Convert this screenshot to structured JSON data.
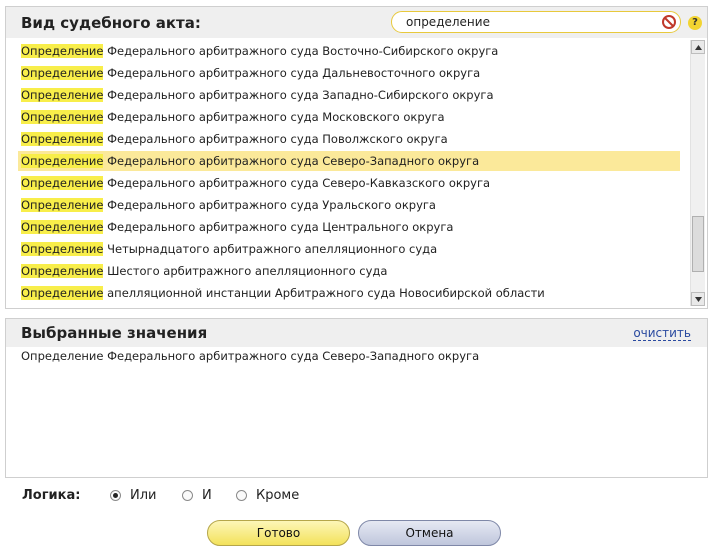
{
  "panel": {
    "title": "Вид судебного акта:",
    "search_value": "определение"
  },
  "help": {
    "glyph": "?"
  },
  "list": {
    "highlight": "Определение",
    "items": [
      {
        "rest": " Федерального арбитражного суда Восточно-Сибирского округа",
        "selected": false
      },
      {
        "rest": " Федерального арбитражного суда Дальневосточного округа",
        "selected": false
      },
      {
        "rest": " Федерального арбитражного суда Западно-Сибирского округа",
        "selected": false
      },
      {
        "rest": " Федерального арбитражного суда Московского округа",
        "selected": false
      },
      {
        "rest": " Федерального арбитражного суда Поволжского округа",
        "selected": false
      },
      {
        "rest": " Федерального арбитражного суда Северо-Западного округа",
        "selected": true
      },
      {
        "rest": " Федерального арбитражного суда Северо-Кавказского округа",
        "selected": false
      },
      {
        "rest": " Федерального арбитражного суда Уральского округа",
        "selected": false
      },
      {
        "rest": " Федерального арбитражного суда Центрального округа",
        "selected": false
      },
      {
        "rest": " Четырнадцатого арбитражного апелляционного суда",
        "selected": false
      },
      {
        "rest": " Шестого арбитражного апелляционного суда",
        "selected": false
      },
      {
        "rest": " апелляционной инстанции Арбитражного суда Новосибирской области",
        "selected": false
      }
    ]
  },
  "selected_panel": {
    "title": "Выбранные значения",
    "clear_label": "очистить",
    "values": [
      "Определение Федерального арбитражного суда Северо-Западного округа"
    ]
  },
  "logic": {
    "label": "Логика:",
    "options": [
      {
        "label": "Или",
        "checked": true
      },
      {
        "label": "И",
        "checked": false
      },
      {
        "label": "Кроме",
        "checked": false
      }
    ]
  },
  "buttons": {
    "ok": "Готово",
    "cancel": "Отмена"
  },
  "colors": {
    "highlight": "#f8ee4a",
    "selected_row": "#fbe99a",
    "ok_button": "#f3e25b",
    "cancel_button": "#bfc6dc"
  }
}
